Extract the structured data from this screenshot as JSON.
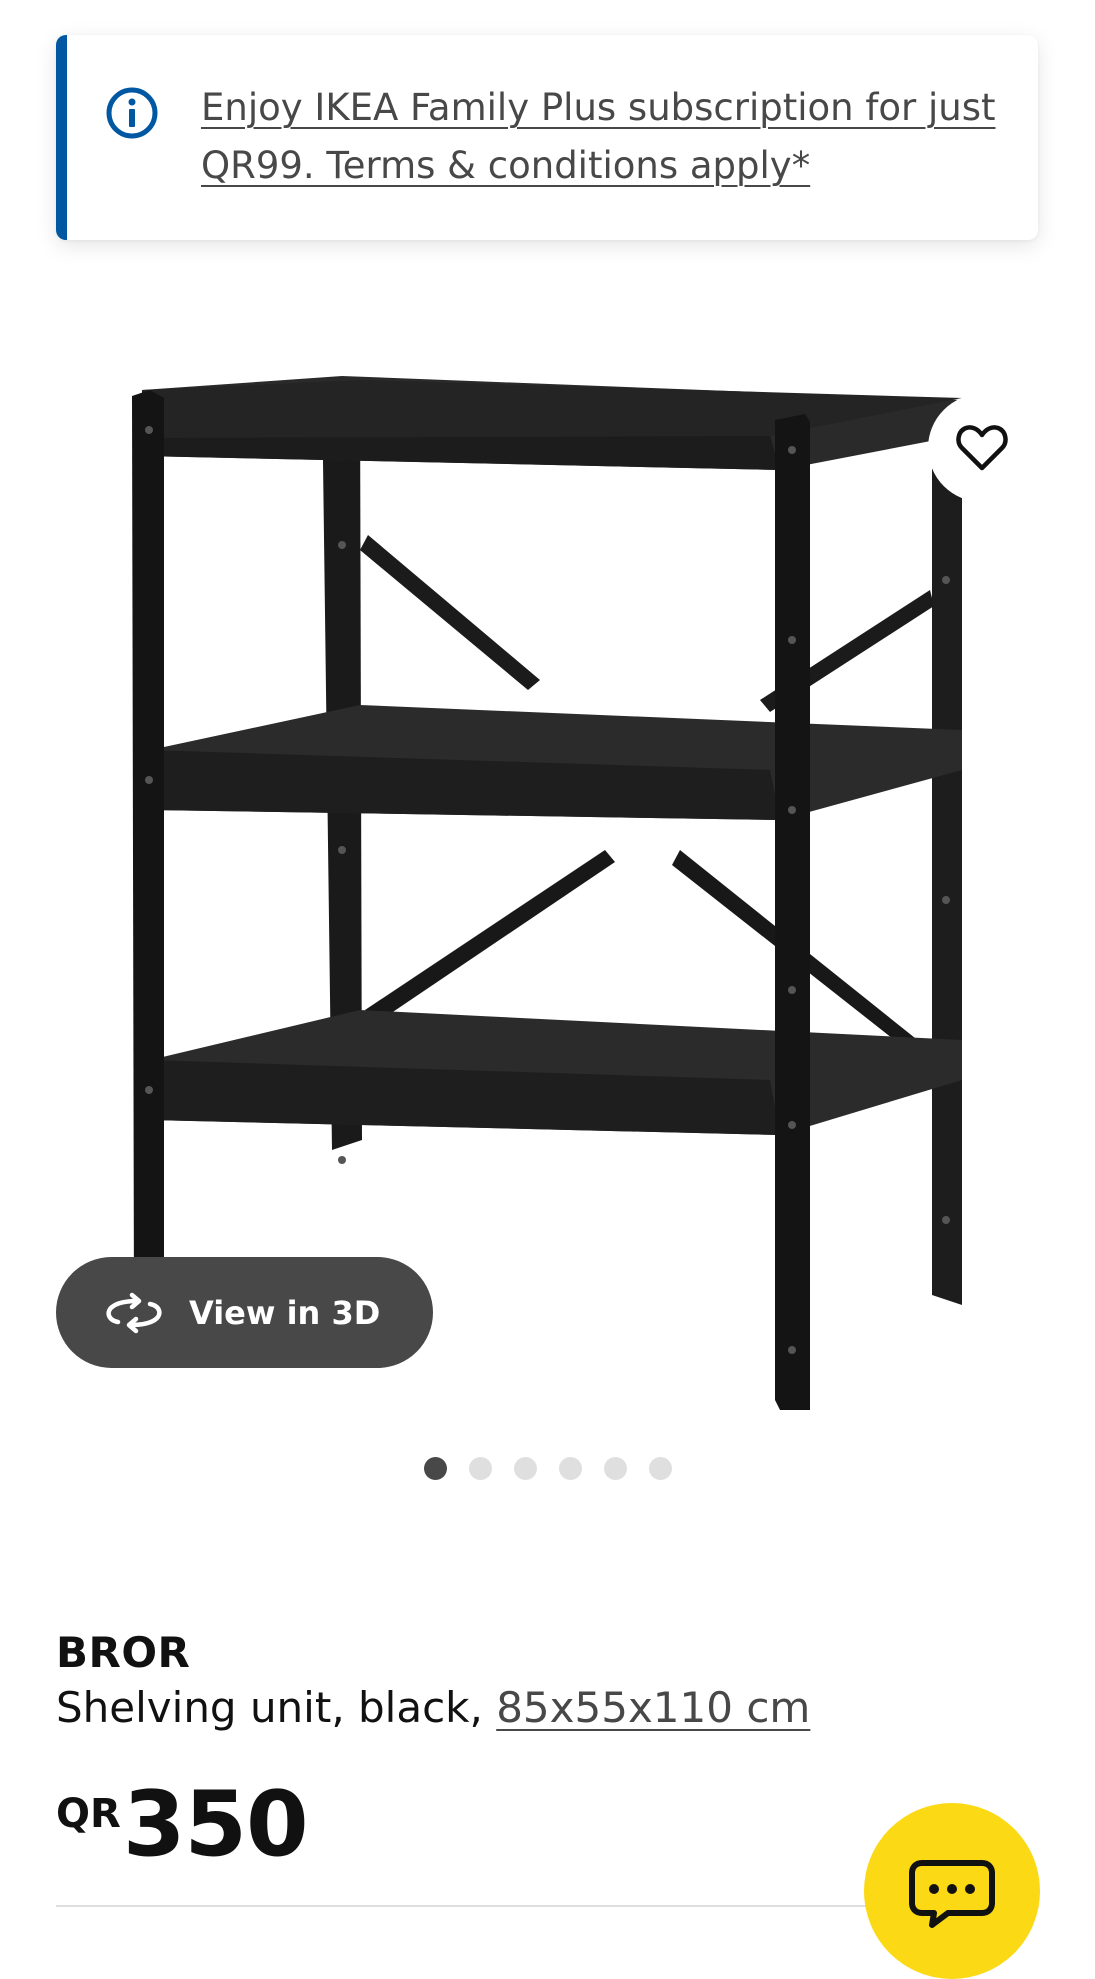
{
  "banner": {
    "icon": "info-icon",
    "text": "Enjoy IKEA Family Plus subscription for just QR99. Terms & conditions apply*",
    "accent_color": "#0058a3"
  },
  "product_media": {
    "favourite_icon": "heart-icon",
    "view_3d_label": "View in 3D",
    "view_3d_icon": "rotate-3d-icon",
    "image_count": 6,
    "active_image_index": 0
  },
  "product": {
    "name": "BROR",
    "description": "Shelving unit, black, ",
    "dimensions": "85x55x110 cm",
    "price_currency": "QR",
    "price_amount": "350"
  },
  "chat": {
    "icon": "chat-bubble-icon",
    "color": "#fbd914"
  }
}
